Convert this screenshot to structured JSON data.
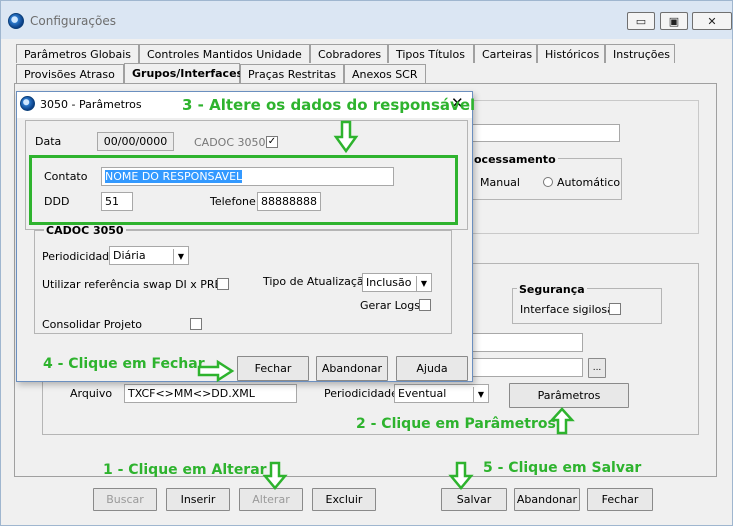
{
  "window": {
    "title": "Configurações",
    "minimize_label": "▭",
    "restore_label": "▣",
    "close_label": "✕"
  },
  "tabs_row1": [
    "Parâmetros Globais",
    "Controles Mantidos Unidade",
    "Cobradores",
    "Tipos Títulos",
    "Carteiras",
    "Históricos",
    "Instruções"
  ],
  "tabs_row2": [
    "Provisões Atraso",
    "Grupos/Interfaces",
    "Praças Restritas",
    "Anexos SCR"
  ],
  "main": {
    "processamento_title": "ocessamento",
    "radio_manual": "Manual",
    "radio_automatico": "Automático",
    "seguranca_title": "Segurança",
    "interface_sigilosa": "Interface sigilosa",
    "arquivo_label": "Arquivo",
    "arquivo_value": "TXCF<>MM<>DD.XML",
    "periodicidade_label": "Periodicidade",
    "periodicidade_value": "Eventual",
    "parametros_button": "Parâmetros",
    "ellipsis_button": "..."
  },
  "bottom_buttons": {
    "buscar": "Buscar",
    "inserir": "Inserir",
    "alterar": "Alterar",
    "excluir": "Excluir",
    "salvar": "Salvar",
    "abandonar": "Abandonar",
    "fechar": "Fechar"
  },
  "dialog": {
    "title": "3050 - Parâmetros",
    "close_label": "✕",
    "data_label": "Data",
    "data_value": "00/00/0000",
    "cadoc_label": "CADOC 3050",
    "contato_label": "Contato",
    "contato_value": "NOME DO RESPONSAVEL",
    "ddd_label": "DDD",
    "ddd_value": "51",
    "telefone_label": "Telefone",
    "telefone_value": "88888888",
    "cadoc_group_title": "CADOC 3050",
    "periodicidade_label": "Periodicidade",
    "periodicidade_value": "Diária",
    "swap_label": "Utilizar referência swap DI x PRE",
    "tipo_atualizacao_label": "Tipo de Atualização",
    "tipo_atualizacao_value": "Inclusão",
    "gerar_logs_label": "Gerar Logs",
    "consolidar_label": "Consolidar Projeto",
    "fechar_button": "Fechar",
    "abandonar_button": "Abandonar",
    "ajuda_button": "Ajuda"
  },
  "annotations": {
    "step1": "1 - Clique em Alterar",
    "step2": "2 - Clique em Parâmetros",
    "step3": "3 - Altere os dados do  responsável",
    "step4": "4 - Clique em Fechar",
    "step5": "5 - Clique em Salvar",
    "color": "#2eb32e"
  }
}
